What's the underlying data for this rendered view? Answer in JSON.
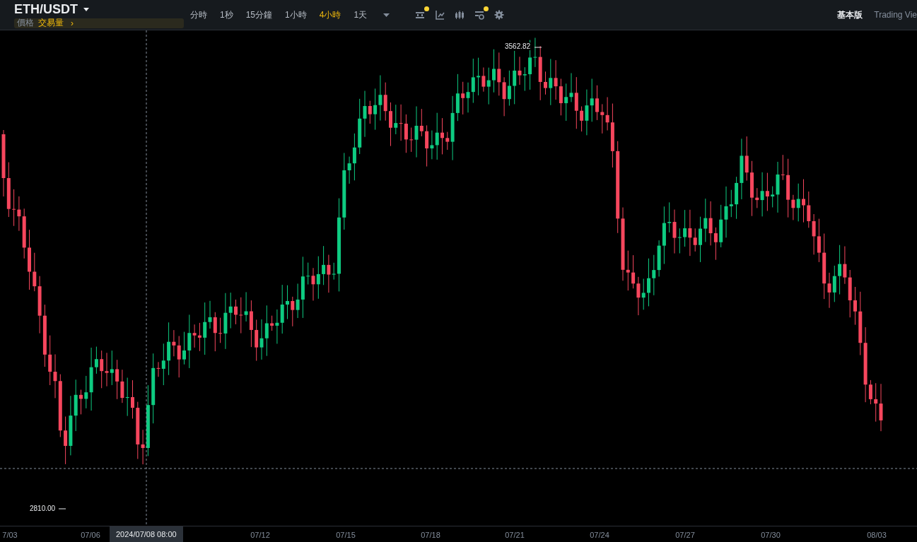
{
  "pair": {
    "symbol": "ETH/USDT"
  },
  "series_tabs": [
    {
      "label": "價格",
      "selected": false
    },
    {
      "label": "交易量",
      "selected": true
    }
  ],
  "series_more": "›",
  "timeframes": [
    {
      "label": "分時",
      "selected": false
    },
    {
      "label": "1秒",
      "selected": false
    },
    {
      "label": "15分鐘",
      "selected": false
    },
    {
      "label": "1小時",
      "selected": false
    },
    {
      "label": "4小時",
      "selected": true
    },
    {
      "label": "1天",
      "selected": false
    }
  ],
  "tools": [
    {
      "kind": "calendar",
      "dot": true
    },
    {
      "kind": "draw",
      "dot": false
    },
    {
      "kind": "candles",
      "dot": false
    },
    {
      "kind": "indicators",
      "dot": true
    },
    {
      "kind": "settings",
      "dot": false
    }
  ],
  "view_modes": [
    {
      "label": "基本版",
      "selected": true
    },
    {
      "label": "Trading Vie",
      "selected": false
    }
  ],
  "chart": {
    "high_label": "3562.82",
    "low_label": "2810.00",
    "crosshair_time": "2024/07/08 08:00",
    "x_labels": [
      "7/03",
      "07/06",
      "07/12",
      "07/15",
      "07/18",
      "07/21",
      "07/24",
      "07/27",
      "07/30",
      "08/03"
    ]
  }
}
